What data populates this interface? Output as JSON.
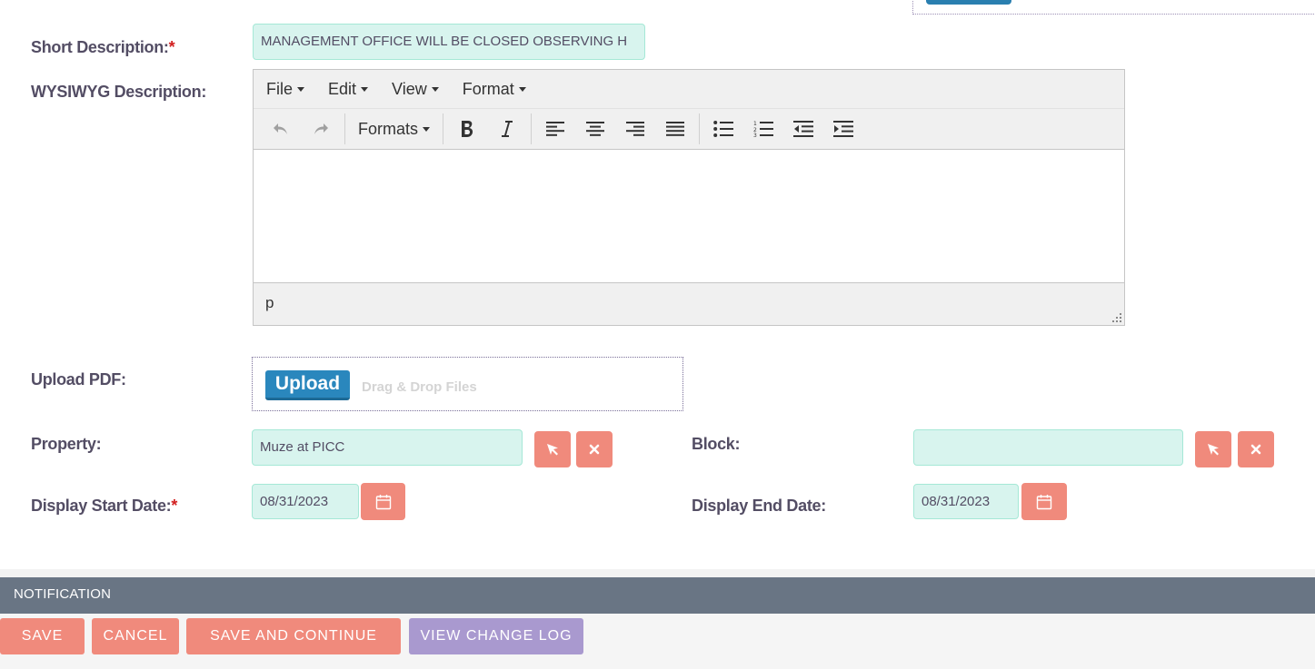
{
  "form": {
    "short_description": {
      "label": "Short Description:",
      "required_mark": "*",
      "value": "MANAGEMENT OFFICE WILL BE CLOSED OBSERVING H"
    },
    "wysiwyg": {
      "label": "WYSIWYG Description:",
      "menus": [
        "File",
        "Edit",
        "View",
        "Format"
      ],
      "formats_label": "Formats",
      "status_path": "p",
      "toolbar_icons": [
        "undo-icon",
        "redo-icon",
        "bold-icon",
        "italic-icon",
        "align-left-icon",
        "align-center-icon",
        "align-right-icon",
        "align-justify-icon",
        "bullet-list-icon",
        "numbered-list-icon",
        "outdent-icon",
        "indent-icon"
      ]
    },
    "upload_pdf": {
      "label": "Upload PDF:",
      "button_label": "Upload",
      "drop_text": "Drag & Drop Files"
    },
    "property": {
      "label": "Property:",
      "value": "Muze at PICC"
    },
    "block": {
      "label": "Block:",
      "value": ""
    },
    "display_start_date": {
      "label": "Display Start Date:",
      "required_mark": "*",
      "value": "08/31/2023"
    },
    "display_end_date": {
      "label": "Display End Date:",
      "value": "08/31/2023"
    }
  },
  "section": {
    "title": "NOTIFICATION"
  },
  "actions": {
    "save": "SAVE",
    "cancel": "CANCEL",
    "save_continue": "SAVE AND CONTINUE",
    "view_change_log": "VIEW CHANGE LOG"
  },
  "colors": {
    "accent_salmon": "#f08a7c",
    "input_bg": "#d8f4ee",
    "upload_blue": "#2a87bd",
    "change_log_purple": "#a999cf",
    "section_bar": "#697584"
  }
}
